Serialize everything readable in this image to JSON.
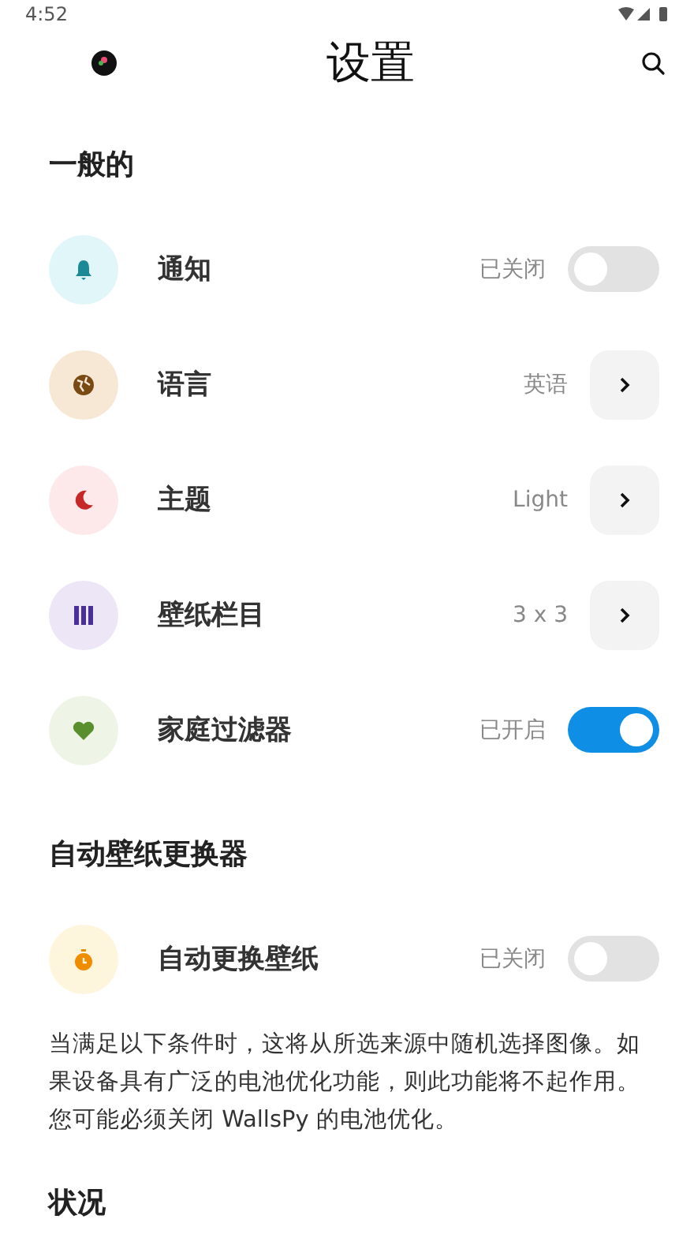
{
  "status_bar": {
    "time": "4:52"
  },
  "header": {
    "title": "设置"
  },
  "sections": [
    {
      "title": "一般的",
      "rows": [
        {
          "kind": "toggle",
          "color": "#e0f6f8",
          "label": "通知",
          "value": "已关闭",
          "on": false
        },
        {
          "kind": "link",
          "color": "#f7e8d6",
          "label": "语言",
          "value": "英语"
        },
        {
          "kind": "link",
          "color": "#fde8ea",
          "label": "主题",
          "value": "Light"
        },
        {
          "kind": "link",
          "color": "#ece6f6",
          "label": "壁纸栏目",
          "value": "3 x 3"
        },
        {
          "kind": "toggle",
          "color": "#eef5e6",
          "label": "家庭过滤器",
          "value": "已开启",
          "on": true
        }
      ]
    },
    {
      "title": "自动壁纸更换器",
      "rows": [
        {
          "kind": "toggle",
          "color": "#fdf5dc",
          "label": "自动更换壁纸",
          "value": "已关闭",
          "on": false
        }
      ],
      "note": "当满足以下条件时，这将从所选来源中随机选择图像。如果设备具有广泛的电池优化功能，则此功能将不起作用。您可能必须关闭 WallsPy 的电池优化。"
    },
    {
      "title": "状况"
    }
  ]
}
